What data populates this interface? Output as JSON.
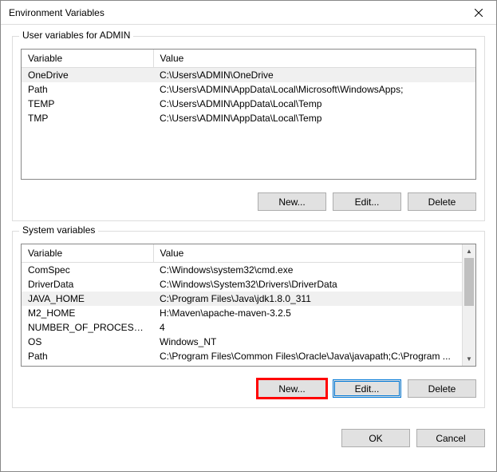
{
  "title": "Environment Variables",
  "user_section": {
    "label": "User variables for ADMIN",
    "columns": {
      "variable": "Variable",
      "value": "Value"
    },
    "rows": [
      {
        "variable": "OneDrive",
        "value": "C:\\Users\\ADMIN\\OneDrive",
        "selected": true
      },
      {
        "variable": "Path",
        "value": "C:\\Users\\ADMIN\\AppData\\Local\\Microsoft\\WindowsApps;",
        "selected": false
      },
      {
        "variable": "TEMP",
        "value": "C:\\Users\\ADMIN\\AppData\\Local\\Temp",
        "selected": false
      },
      {
        "variable": "TMP",
        "value": "C:\\Users\\ADMIN\\AppData\\Local\\Temp",
        "selected": false
      }
    ],
    "buttons": {
      "new": "New...",
      "edit": "Edit...",
      "delete": "Delete"
    }
  },
  "system_section": {
    "label": "System variables",
    "columns": {
      "variable": "Variable",
      "value": "Value"
    },
    "rows": [
      {
        "variable": "ComSpec",
        "value": "C:\\Windows\\system32\\cmd.exe",
        "selected": false
      },
      {
        "variable": "DriverData",
        "value": "C:\\Windows\\System32\\Drivers\\DriverData",
        "selected": false
      },
      {
        "variable": "JAVA_HOME",
        "value": "C:\\Program Files\\Java\\jdk1.8.0_311",
        "selected": true
      },
      {
        "variable": "M2_HOME",
        "value": "H:\\Maven\\apache-maven-3.2.5",
        "selected": false
      },
      {
        "variable": "NUMBER_OF_PROCESSORS",
        "value": "4",
        "selected": false
      },
      {
        "variable": "OS",
        "value": "Windows_NT",
        "selected": false
      },
      {
        "variable": "Path",
        "value": "C:\\Program Files\\Common Files\\Oracle\\Java\\javapath;C:\\Program ...",
        "selected": false
      }
    ],
    "buttons": {
      "new": "New...",
      "edit": "Edit...",
      "delete": "Delete"
    }
  },
  "dialog_buttons": {
    "ok": "OK",
    "cancel": "Cancel"
  }
}
